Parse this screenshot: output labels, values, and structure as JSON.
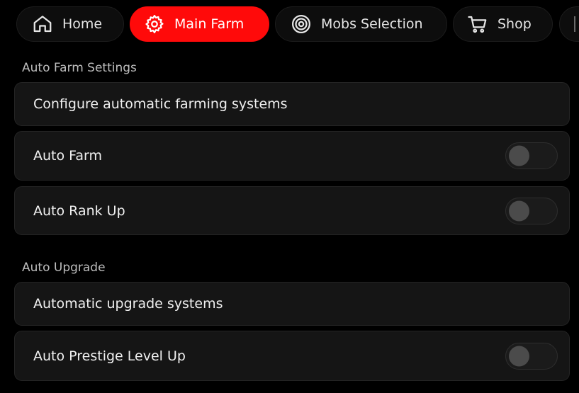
{
  "tabs": [
    {
      "label": "Home",
      "icon": "home-icon",
      "active": false
    },
    {
      "label": "Main Farm",
      "icon": "gear-icon",
      "active": true
    },
    {
      "label": "Mobs Selection",
      "icon": "target-icon",
      "active": false
    },
    {
      "label": "Shop",
      "icon": "cart-icon",
      "active": false
    }
  ],
  "sections": {
    "auto_farm": {
      "title": "Auto Farm Settings",
      "description": "Configure automatic farming systems",
      "toggles": [
        {
          "label": "Auto Farm",
          "on": false
        },
        {
          "label": "Auto Rank Up",
          "on": false
        }
      ]
    },
    "auto_upgrade": {
      "title": "Auto Upgrade",
      "description": "Automatic upgrade systems",
      "toggles": [
        {
          "label": "Auto Prestige Level Up",
          "on": false
        }
      ]
    }
  },
  "colors": {
    "accent": "#ff0a0a",
    "background": "#000000",
    "card": "#151515",
    "toggle_off_knob": "#4b4b4b"
  }
}
